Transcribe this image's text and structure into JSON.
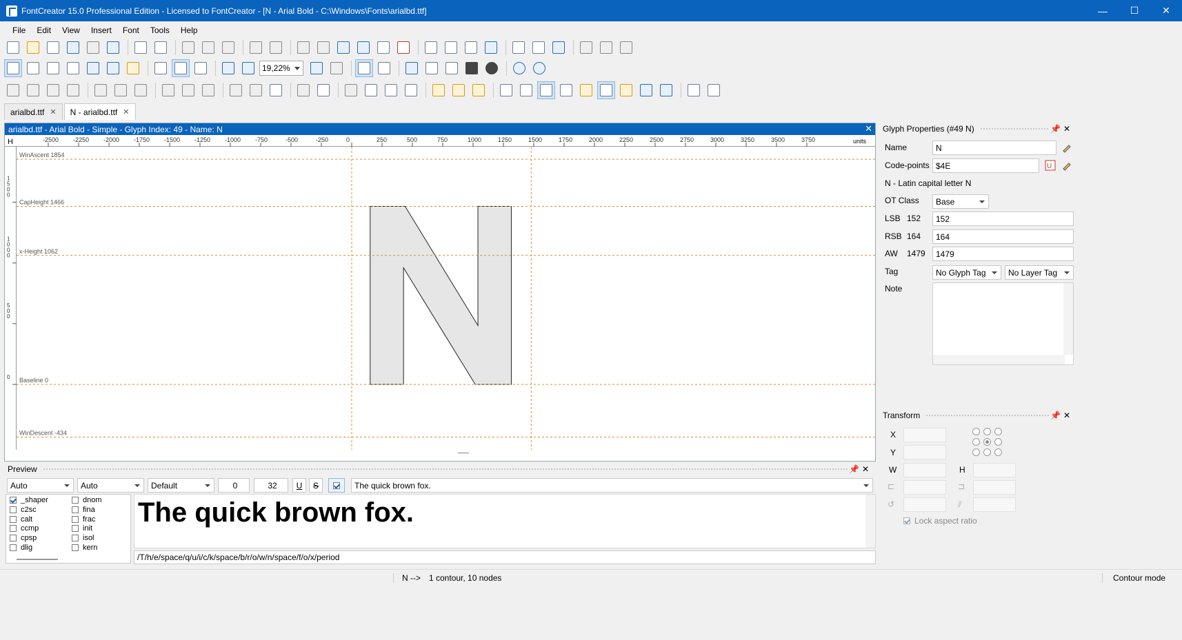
{
  "window": {
    "title": "FontCreator 15.0 Professional Edition - Licensed to FontCreator - [N - Arial Bold - C:\\Windows\\Fonts\\arialbd.ttf]",
    "controls": {
      "minimize": "—",
      "maximize": "☐",
      "close": "✕"
    }
  },
  "menu": [
    "File",
    "Edit",
    "View",
    "Insert",
    "Font",
    "Tools",
    "Help"
  ],
  "toolbar": {
    "zoom_value": "19,22%"
  },
  "tabs": [
    {
      "label": "arialbd.ttf",
      "active": false
    },
    {
      "label": "N - arialbd.ttf",
      "active": true
    }
  ],
  "editor": {
    "header": "arialbd.ttf - Arial Bold - Simple - Glyph Index: 49 - Name: N",
    "ruler_corner": "H",
    "ruler_unit": "units",
    "ruler_ticks": [
      "-2500",
      "-2250",
      "-2000",
      "-1750",
      "-1500",
      "-1250",
      "-1000",
      "-750",
      "-500",
      "-250",
      "0",
      "250",
      "500",
      "750",
      "1000",
      "1250",
      "1500",
      "1750",
      "2000",
      "2250",
      "2500",
      "2750",
      "3000",
      "3250",
      "3500",
      "3750"
    ],
    "vruler_ticks": [
      "1500",
      "1000",
      "500",
      "0"
    ],
    "metrics": [
      {
        "label": "WinAscent 1854",
        "value": 1854
      },
      {
        "label": "CapHeight 1466",
        "value": 1466
      },
      {
        "label": "x-Height 1062",
        "value": 1062
      },
      {
        "label": "Baseline 0",
        "value": 0
      },
      {
        "label": "WinDescent -434",
        "value": -434
      }
    ],
    "glyph_char": "N",
    "advance_width": 1479
  },
  "glyph_properties": {
    "title": "Glyph Properties (#49 N)",
    "name_label": "Name",
    "name_value": "N",
    "codepoints_label": "Code-points",
    "codepoints_value": "$4E",
    "description": "N - Latin capital letter N",
    "otclass_label": "OT Class",
    "otclass_value": "Base",
    "lsb_label": "LSB",
    "lsb_current": "152",
    "lsb_value": "152",
    "rsb_label": "RSB",
    "rsb_current": "164",
    "rsb_value": "164",
    "aw_label": "AW",
    "aw_current": "1479",
    "aw_value": "1479",
    "tag_label": "Tag",
    "glyph_tag": "No Glyph Tag",
    "layer_tag": "No Layer Tag",
    "note_label": "Note"
  },
  "transform": {
    "title": "Transform",
    "x_label": "X",
    "y_label": "Y",
    "w_label": "W",
    "h_label": "H",
    "lock_label": "Lock aspect ratio"
  },
  "preview": {
    "title": "Preview",
    "dropdown1": "Auto",
    "dropdown2": "Auto",
    "dropdown3": "Default",
    "spin1": "0",
    "spin2": "32",
    "underline_btn": "U",
    "strike_btn": "S",
    "text_value": "The quick brown fox.",
    "rendered_text": "The quick brown fox.",
    "glyph_string": "/T/h/e/space/q/u/i/c/k/space/b/r/o/w/n/space/f/o/x/period",
    "features_col1": [
      {
        "name": "_shaper",
        "checked": true
      },
      {
        "name": "c2sc",
        "checked": false
      },
      {
        "name": "calt",
        "checked": false
      },
      {
        "name": "ccmp",
        "checked": false
      },
      {
        "name": "cpsp",
        "checked": false
      },
      {
        "name": "dlig",
        "checked": false
      }
    ],
    "features_col2": [
      {
        "name": "dnom",
        "checked": false
      },
      {
        "name": "fina",
        "checked": false
      },
      {
        "name": "frac",
        "checked": false
      },
      {
        "name": "init",
        "checked": false
      },
      {
        "name": "isol",
        "checked": false
      },
      {
        "name": "kern",
        "checked": false
      }
    ]
  },
  "status": {
    "glyph": "N -->",
    "info": "1 contour, 10 nodes",
    "mode": "Contour mode"
  }
}
